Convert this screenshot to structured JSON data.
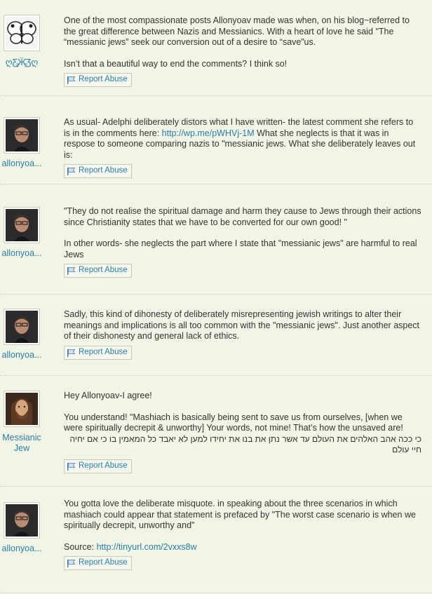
{
  "report_label": "Report Abuse",
  "comments": [
    {
      "author": "ღƸ̵̡Ӝ̵̨̄Ʒღ",
      "p1": "One of the most compassionate posts Allonyoav made was when, on his blog~referred to the great difference between Nazis and Messianics. With a heart of love he said \"The “messianic jews” seek our conversion out of a desire to “save”us.",
      "p2": "Isn’t that a beautiful way to end the comments? I think so!"
    },
    {
      "author": "allonyoa...",
      "p1_pre": "As usual- Adelphi deliberately distors what I have written- the latest comment she refers to is in the comments here: ",
      "p1_link": "http://wp.me/pWHVj-1M",
      "p1_post": " What she neglects is that it was in respose to someone comparing nazis to \"messianic jews. What she deliberately leaves out is:"
    },
    {
      "author": "allonyoa...",
      "p1": "\"They do not realise the spiritual damage and harm they cause to Jews through their actions since Christianity states that we have to be converted for our own good! \"",
      "p2": "In other words- she neglects the part where I state that \"messianic jews\" are harmful to real Jews"
    },
    {
      "author": "allonyoa...",
      "p1": "Sadly, this kind of dihonesty of deliberately misrepresenting jewish writings to alter their meanings and implications is all too common with the \"messianic jews\". Just another aspect of their dishonesty and general lack of ethics."
    },
    {
      "author": "Messianic Jew",
      "p1": "Hey Allonyoav-I agree!",
      "p2": "You understand! \"Mashiach is basically being sent to save us from ourselves, [when we were spiritually decrepit & unworthy] Your words, not mine! That’s how the unsaved are!",
      "hebrew": "כי ככה אהב האלהים את העולם עד אשר נתן את בנו את יחידו למען לא יאבד כל המאמין בו כי אם יחיה חיי עולם"
    },
    {
      "author": "allonyoa...",
      "p1": "You gotta love the deliberate misquote. in speaking about the three scenarios in which mashiach could appear that statement is prefaced by \"The worst case scenario is when we spiritually decrepit, unworthy and\"",
      "p2_pre": "Source: ",
      "p2_link": "http://tinyurl.com/2vxxs8w"
    }
  ]
}
